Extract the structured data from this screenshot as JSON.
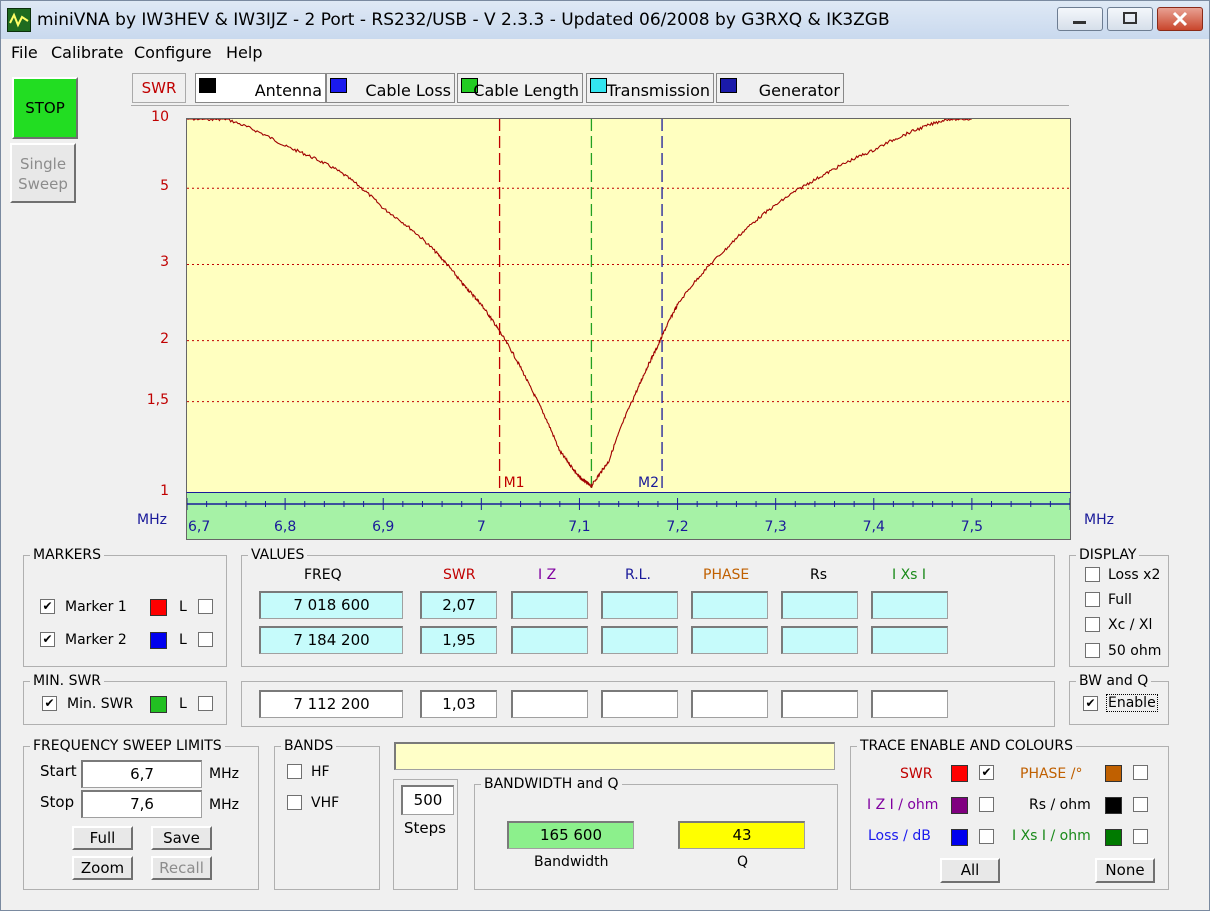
{
  "window": {
    "title": "miniVNA by IW3HEV & IW3IJZ - 2 Port - RS232/USB - V 2.3.3 - Updated 06/2008 by G3RXQ & IK3ZGB"
  },
  "menu": [
    "File",
    "Calibrate",
    "Configure",
    "Help"
  ],
  "left": {
    "stop": "STOP",
    "single_line1": "Single",
    "single_line2": "Sweep",
    "stop_color": "#22dd22"
  },
  "tabs": {
    "mode": "SWR",
    "antenna": "Antenna",
    "cable_loss": "Cable Loss",
    "cable_length": "Cable Length",
    "transmission": "Transmission",
    "generator": "Generator"
  },
  "chart_data": {
    "type": "line",
    "yaxis_labels": [
      "10",
      "5",
      "3",
      "2",
      "1,5",
      "1"
    ],
    "y_ticks": [
      10,
      5,
      3,
      2,
      1.5,
      1
    ],
    "y_scale": "log-like (SWR reflection scale)",
    "xaxis_labels": [
      "6,7",
      "6,8",
      "6,9",
      "7",
      "7,1",
      "7,2",
      "7,3",
      "7,4",
      "7,5"
    ],
    "x_ticks": [
      6.7,
      6.8,
      6.9,
      7.0,
      7.1,
      7.2,
      7.3,
      7.4,
      7.5
    ],
    "xlim": [
      6.7,
      7.6
    ],
    "ylim": [
      1,
      10
    ],
    "x_unit": "MHz",
    "grid": "horizontal dotted",
    "series": [
      {
        "name": "SWR",
        "color": "#a00000",
        "x": [
          6.7,
          6.74,
          6.8,
          6.85,
          6.9,
          6.95,
          6.98,
          7.0,
          7.02,
          7.05,
          7.08,
          7.1,
          7.112,
          7.13,
          7.16,
          7.18,
          7.2,
          7.25,
          7.3,
          7.35,
          7.4,
          7.45,
          7.5
        ],
        "y": [
          12,
          10,
          7.3,
          5.9,
          4.3,
          3.3,
          2.7,
          2.4,
          2.07,
          1.6,
          1.2,
          1.07,
          1.03,
          1.15,
          1.6,
          1.95,
          2.4,
          3.3,
          4.4,
          5.6,
          7.0,
          9.0,
          11
        ]
      }
    ],
    "markers": [
      {
        "label": "M1",
        "x": 7.0186,
        "color": "#c00000"
      },
      {
        "label": "M2",
        "x": 7.1842,
        "color": "#1a1a9a"
      },
      {
        "label": "",
        "x": 7.1122,
        "color": "#22a022"
      }
    ]
  },
  "markers_panel": {
    "legend": "MARKERS",
    "m1": "Marker 1",
    "m2": "Marker 2",
    "l": "L",
    "m1_color": "#ff0000",
    "m2_color": "#0000ee"
  },
  "values_panel": {
    "legend": "VALUES",
    "headers": {
      "freq": "FREQ",
      "swr": "SWR",
      "iz": "I Z",
      "rl": "R.L.",
      "phase": "PHASE",
      "rs": "Rs",
      "xs": "I Xs I"
    },
    "row1": {
      "freq": "7 018 600",
      "swr": "2,07"
    },
    "row2": {
      "freq": "7 184 200",
      "swr": "1,95"
    },
    "min": {
      "freq": "7 112 200",
      "swr": "1,03"
    }
  },
  "display_panel": {
    "legend": "DISPLAY",
    "loss": "Loss x2",
    "full": "Full",
    "xcxl": "Xc / Xl",
    "ohm50": "50 ohm"
  },
  "minswr_panel": {
    "legend": "MIN. SWR",
    "label": "Min. SWR",
    "l": "L",
    "color": "#22c022"
  },
  "bwq_panel": {
    "legend": "BW and Q",
    "enable": "Enable"
  },
  "sweep_panel": {
    "legend": "FREQUENCY SWEEP LIMITS",
    "start_label": "Start",
    "start": "6,7",
    "stop_label": "Stop",
    "stop": "7,6",
    "unit": "MHz",
    "full": "Full",
    "save": "Save",
    "zoom": "Zoom",
    "recall": "Recall"
  },
  "bands_panel": {
    "legend": "BANDS",
    "hf": "HF",
    "vhf": "VHF"
  },
  "steps": {
    "value": "500",
    "label": "Steps"
  },
  "bw_panel": {
    "legend": "BANDWIDTH and Q",
    "bandwidth": "165 600",
    "bandwidth_label": "Bandwidth",
    "q": "43",
    "q_label": "Q"
  },
  "trace_panel": {
    "legend": "TRACE ENABLE AND COLOURS",
    "swr": "SWR",
    "iz": "I Z I / ohm",
    "loss": "Loss / dB",
    "phase": "PHASE /°",
    "rs": "Rs / ohm",
    "xs": "I Xs I / ohm",
    "all": "All",
    "none": "None"
  }
}
